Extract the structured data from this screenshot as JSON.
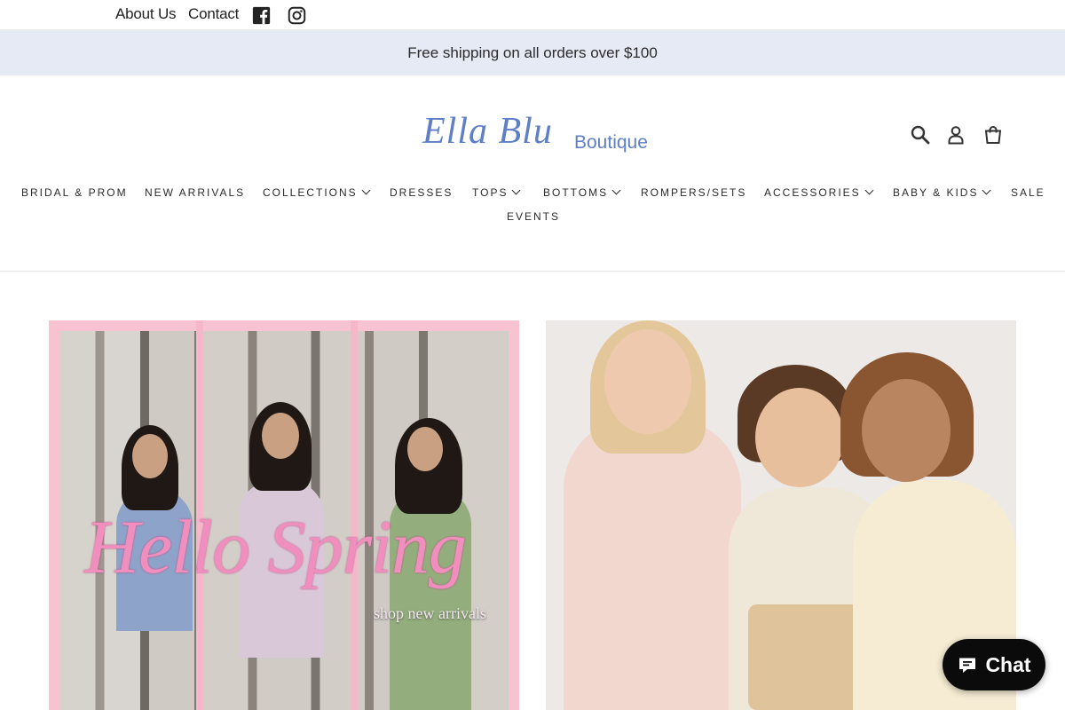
{
  "util_bar": {
    "about_label": "About Us",
    "contact_label": "Contact",
    "social_icons": [
      "facebook-icon",
      "instagram-icon"
    ]
  },
  "announcement": {
    "text": "Free shipping on all orders over $100"
  },
  "header": {
    "logo_script": "Ella Blu",
    "logo_sub": "Boutique",
    "icons": [
      "search-icon",
      "account-icon",
      "cart-icon"
    ]
  },
  "nav": {
    "items": [
      {
        "label": "BRIDAL & PROM",
        "dropdown": false
      },
      {
        "label": "NEW ARRIVALS",
        "dropdown": false
      },
      {
        "label": "COLLECTIONS",
        "dropdown": true
      },
      {
        "label": "DRESSES",
        "dropdown": false
      },
      {
        "label": "TOPS",
        "dropdown": true
      },
      {
        "label": "BOTTOMS",
        "dropdown": true
      },
      {
        "label": "ROMPERS/SETS",
        "dropdown": false
      },
      {
        "label": "ACCESSORIES",
        "dropdown": true
      },
      {
        "label": "BABY & KIDS",
        "dropdown": true
      },
      {
        "label": "SALE",
        "dropdown": false
      },
      {
        "label": "EVENTS",
        "dropdown": false
      }
    ]
  },
  "promo_left": {
    "headline": "Hello Spring",
    "cta": "shop new arrivals"
  },
  "chat": {
    "label": "Chat"
  },
  "colors": {
    "brand_blue": "#5e7fc6",
    "announcement_bg": "#e6eaf4",
    "promo_pink": "#f7c3d3",
    "chat_bg": "#0b0b0b"
  }
}
